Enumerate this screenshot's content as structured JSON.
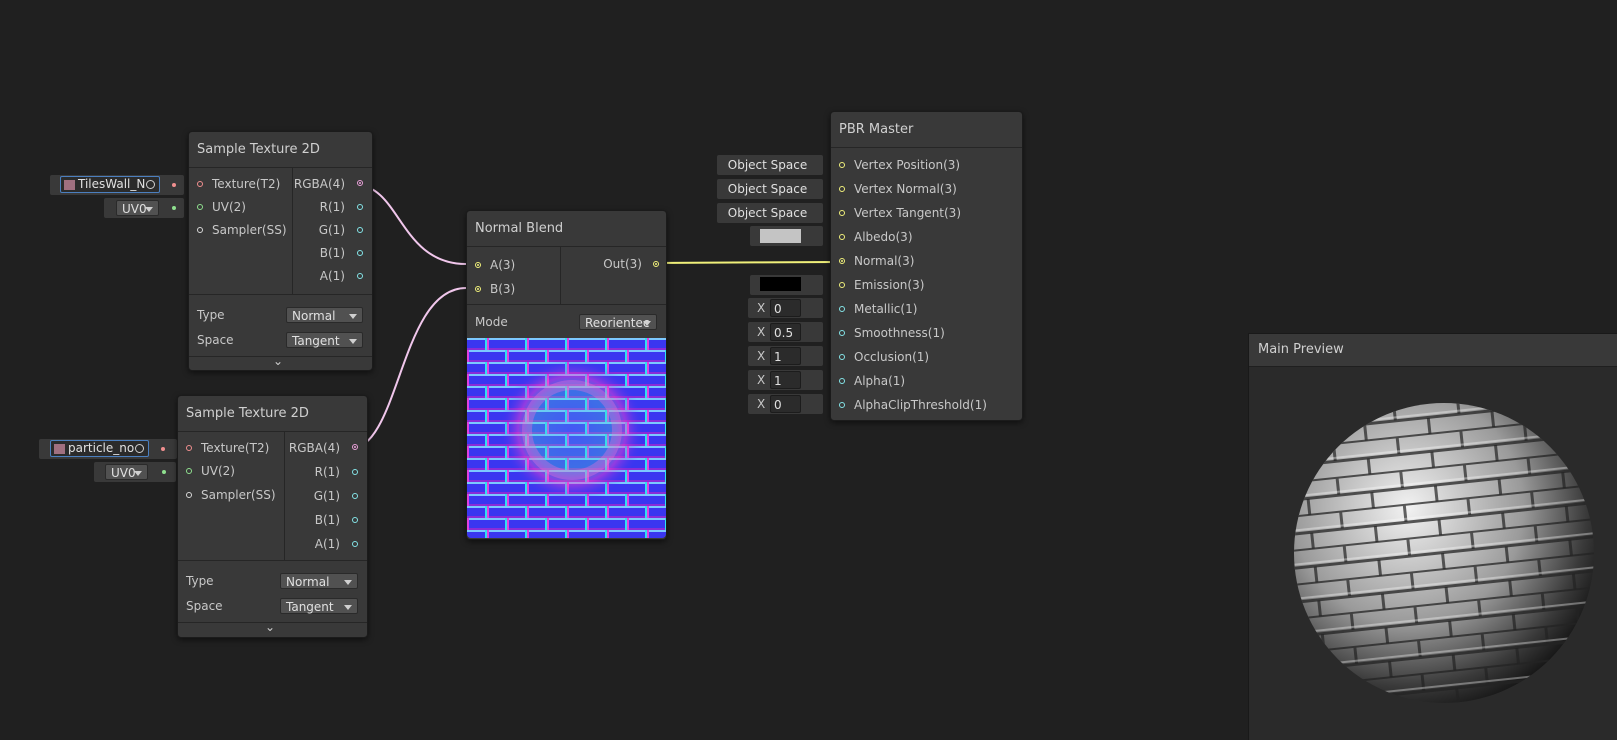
{
  "sample_texture_1": {
    "title": "Sample Texture 2D",
    "inputs": [
      "Texture(T2)",
      "UV(2)",
      "Sampler(SS)"
    ],
    "outputs": [
      "RGBA(4)",
      "R(1)",
      "G(1)",
      "B(1)",
      "A(1)"
    ],
    "texture_field": "TilesWall_N",
    "uv_value": "UV0",
    "type_label": "Type",
    "type_value": "Normal",
    "space_label": "Space",
    "space_value": "Tangent"
  },
  "sample_texture_2": {
    "title": "Sample Texture 2D",
    "inputs": [
      "Texture(T2)",
      "UV(2)",
      "Sampler(SS)"
    ],
    "outputs": [
      "RGBA(4)",
      "R(1)",
      "G(1)",
      "B(1)",
      "A(1)"
    ],
    "texture_field": "particle_no",
    "uv_value": "UV0",
    "type_label": "Type",
    "type_value": "Normal",
    "space_label": "Space",
    "space_value": "Tangent"
  },
  "normal_blend": {
    "title": "Normal Blend",
    "inputs": [
      "A(3)",
      "B(3)"
    ],
    "output": "Out(3)",
    "mode_label": "Mode",
    "mode_value": "Reorientec"
  },
  "pbr_master": {
    "title": "PBR Master",
    "inputs": [
      "Vertex Position(3)",
      "Vertex Normal(3)",
      "Vertex Tangent(3)",
      "Albedo(3)",
      "Normal(3)",
      "Emission(3)",
      "Metallic(1)",
      "Smoothness(1)",
      "Occlusion(1)",
      "Alpha(1)",
      "AlphaClipThreshold(1)"
    ],
    "space_fields": [
      "Object Space",
      "Object Space",
      "Object Space"
    ],
    "axis_label": "X",
    "metallic": "0",
    "smoothness": "0.5",
    "occlusion": "1",
    "alpha": "1",
    "alpha_clip": "0",
    "albedo_color": "#c4c4c4",
    "emission_color": "#000000"
  },
  "main_preview": {
    "title": "Main Preview"
  },
  "colors": {
    "background": "#202020",
    "node": "#393939",
    "vector4_port": "#e8a0d8",
    "texture_port": "#f08f8f",
    "vector2_port": "#8fe08f",
    "vector3_port": "#f0f07a",
    "vector1_port": "#84e4e7"
  }
}
